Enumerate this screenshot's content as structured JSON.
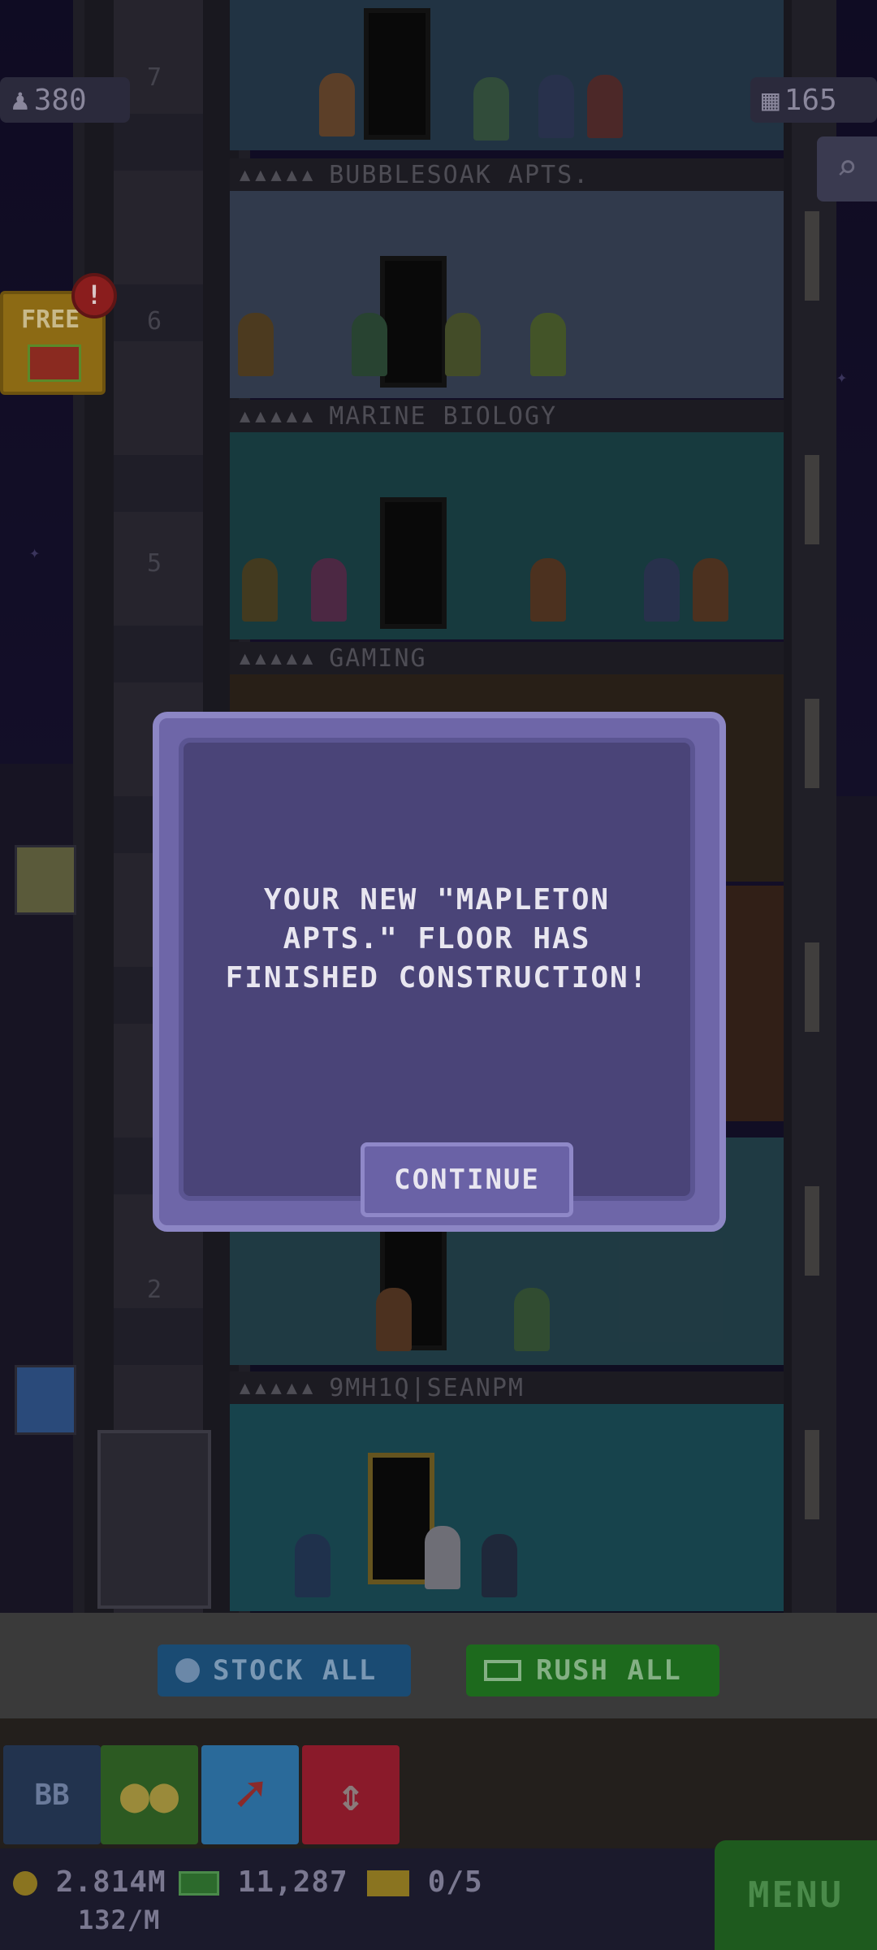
{
  "hud": {
    "population": "380",
    "floors_count": "165",
    "free_label": "FREE",
    "free_badge": "!"
  },
  "floor_labels": {
    "floor_7": "7",
    "floor_6": "6",
    "floor_5": "5",
    "floor_2": "2"
  },
  "floors": [
    {
      "stars": "▲▲▲▲▲",
      "name": "BUBBLESOAK APTS."
    },
    {
      "stars": "▲▲▲▲▲",
      "name": "MARINE BIOLOGY"
    },
    {
      "stars": "▲▲▲▲▲",
      "name": "GAMING"
    },
    {
      "stars": "▲▲▲▲▲",
      "name": "9MH1Q|SEANPM"
    }
  ],
  "modal": {
    "message": "YOUR NEW \"MAPLETON APTS.\" FLOOR HAS FINISHED CONSTRUCTION!",
    "continue_label": "CONTINUE"
  },
  "actions": {
    "stock_all": "STOCK ALL",
    "rush_all": "RUSH ALL"
  },
  "tools": {
    "bb_label": "BB"
  },
  "stats": {
    "coins": "2.814M",
    "coins_rate": "132/M",
    "bux": "11,287",
    "tickets": "0/5"
  },
  "menu_label": "MENU",
  "colors": {
    "modal_bg": "#4a4478",
    "modal_border": "#8c86c4",
    "stock_blue": "#1a4b73",
    "rush_green": "#1d6a1d",
    "menu_green": "#1e5a1e"
  }
}
